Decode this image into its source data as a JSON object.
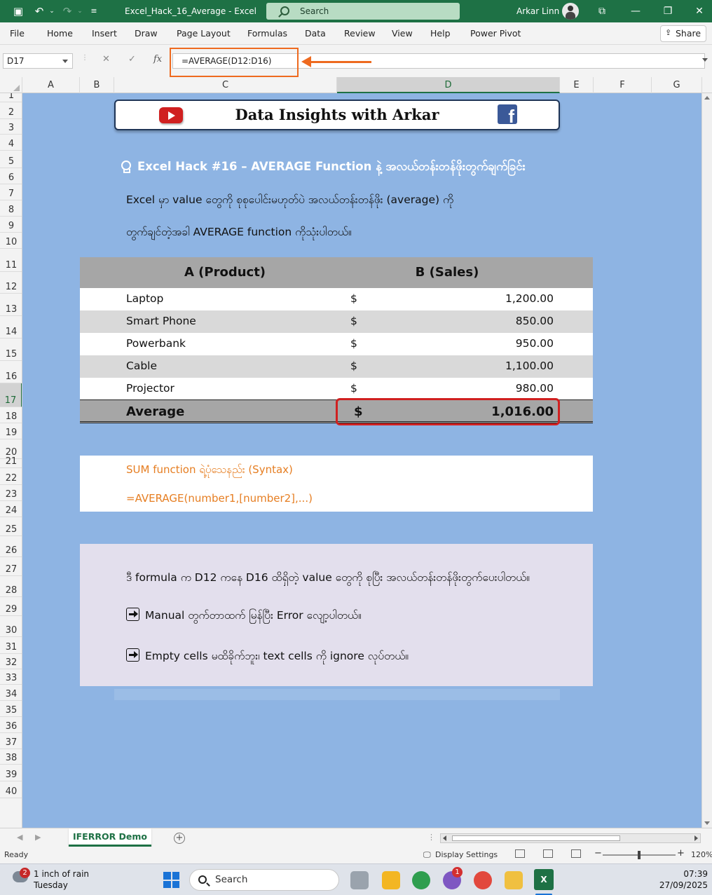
{
  "window": {
    "title": "Excel_Hack_16_Average  -  Excel",
    "search_placeholder": "Search",
    "user_name": "Arkar Linn",
    "controls": {
      "ribbon_display": "⧉",
      "minimize": "—",
      "restore": "❐",
      "close": "✕"
    }
  },
  "qat": {
    "save_icon": "save-icon",
    "undo_icon": "undo-icon",
    "redo_icon": "redo-icon",
    "customize_icon": "customize-icon"
  },
  "ribbon": {
    "tabs": [
      "File",
      "Home",
      "Insert",
      "Draw",
      "Page Layout",
      "Formulas",
      "Data",
      "Review",
      "View",
      "Help",
      "Power Pivot"
    ],
    "share_label": "Share"
  },
  "formula_bar": {
    "name_box": "D17",
    "cancel_icon": "✕",
    "enter_icon": "✓",
    "fx_icon": "fx",
    "formula": "=AVERAGE(D12:D16)"
  },
  "grid": {
    "columns": [
      "A",
      "B",
      "C",
      "D",
      "E",
      "F",
      "G"
    ],
    "selected_column": "D",
    "rows": [
      "1",
      "2",
      "3",
      "4",
      "5",
      "6",
      "7",
      "8",
      "9",
      "10",
      "11",
      "12",
      "13",
      "14",
      "15",
      "16",
      "17",
      "18",
      "19",
      "20",
      "21",
      "22",
      "23",
      "24",
      "25",
      "26",
      "27",
      "28",
      "29",
      "30",
      "31",
      "32",
      "33",
      "34",
      "35",
      "36",
      "37",
      "38",
      "39",
      "40"
    ],
    "selected_row": "17",
    "sheet_bg_color": "#8eb4e3"
  },
  "banner": {
    "title": "Data Insights with Arkar",
    "youtube_icon": "youtube-icon",
    "facebook_icon": "facebook-icon",
    "facebook_glyph": "f"
  },
  "content": {
    "hack_title": "Excel Hack #16 – AVERAGE Function နဲ့ အလယ်တန်းတန်ဖိုးတွက်ချက်ခြင်း",
    "bulb_icon": "lightbulb-icon",
    "intro_line1": "Excel မှာ value တွေကို စုစုပေါင်းမဟုတ်ပဲ အလယ်တန်းတန်ဖိုး (average) ကို",
    "intro_line2": "တွက်ချင်တဲ့အခါ AVERAGE function ကိုသုံးပါတယ်။"
  },
  "table": {
    "headers": [
      "A (Product)",
      "B (Sales)"
    ],
    "rows": [
      {
        "product": "Laptop",
        "currency": "$",
        "sales": "1,200.00",
        "bg": "#ffffff"
      },
      {
        "product": "Smart Phone",
        "currency": "$",
        "sales": "850.00",
        "bg": "#d9d9d9"
      },
      {
        "product": "Powerbank",
        "currency": "$",
        "sales": "950.00",
        "bg": "#ffffff"
      },
      {
        "product": "Cable",
        "currency": "$",
        "sales": "1,100.00",
        "bg": "#d9d9d9"
      },
      {
        "product": "Projector",
        "currency": "$",
        "sales": "980.00",
        "bg": "#ffffff"
      }
    ],
    "average": {
      "label": "Average",
      "currency": "$",
      "value": "1,016.00"
    }
  },
  "syntax": {
    "heading": "SUM function ရဲ့ပုံသေနည်း (Syntax)",
    "formula": "=AVERAGE(number1,[number2],...)"
  },
  "notes": {
    "line1": "ဒီ formula က D12 ကနေ D16 ထိရှိတဲ့ value တွေကို စုပြီး အလယ်တန်းတန်ဖိုးတွက်ပေးပါတယ်။",
    "line2": "Manual တွက်တာထက် မြန်ပြီး Error လျော့ပါတယ်။",
    "line3": "Empty cells မထိခိုက်ဘူး၊ text cells ကို ignore လုပ်တယ်။",
    "bullet_icon": "arrow-right-box-icon"
  },
  "sheet_tabs": {
    "active": "IFERROR Demo",
    "add_icon": "+"
  },
  "status_bar": {
    "mode": "Ready",
    "display_settings": "Display Settings",
    "zoom_minus": "−",
    "zoom_plus": "+",
    "zoom": "120%",
    "zoom_fraction": 0.5
  },
  "taskbar": {
    "weather_line1": "1 inch of rain",
    "weather_line2": "Tuesday",
    "weather_badge": "2",
    "search_placeholder": "Search",
    "app_badge": "1",
    "excel_glyph": "X",
    "time": "07:39",
    "date": "27/09/2025"
  }
}
